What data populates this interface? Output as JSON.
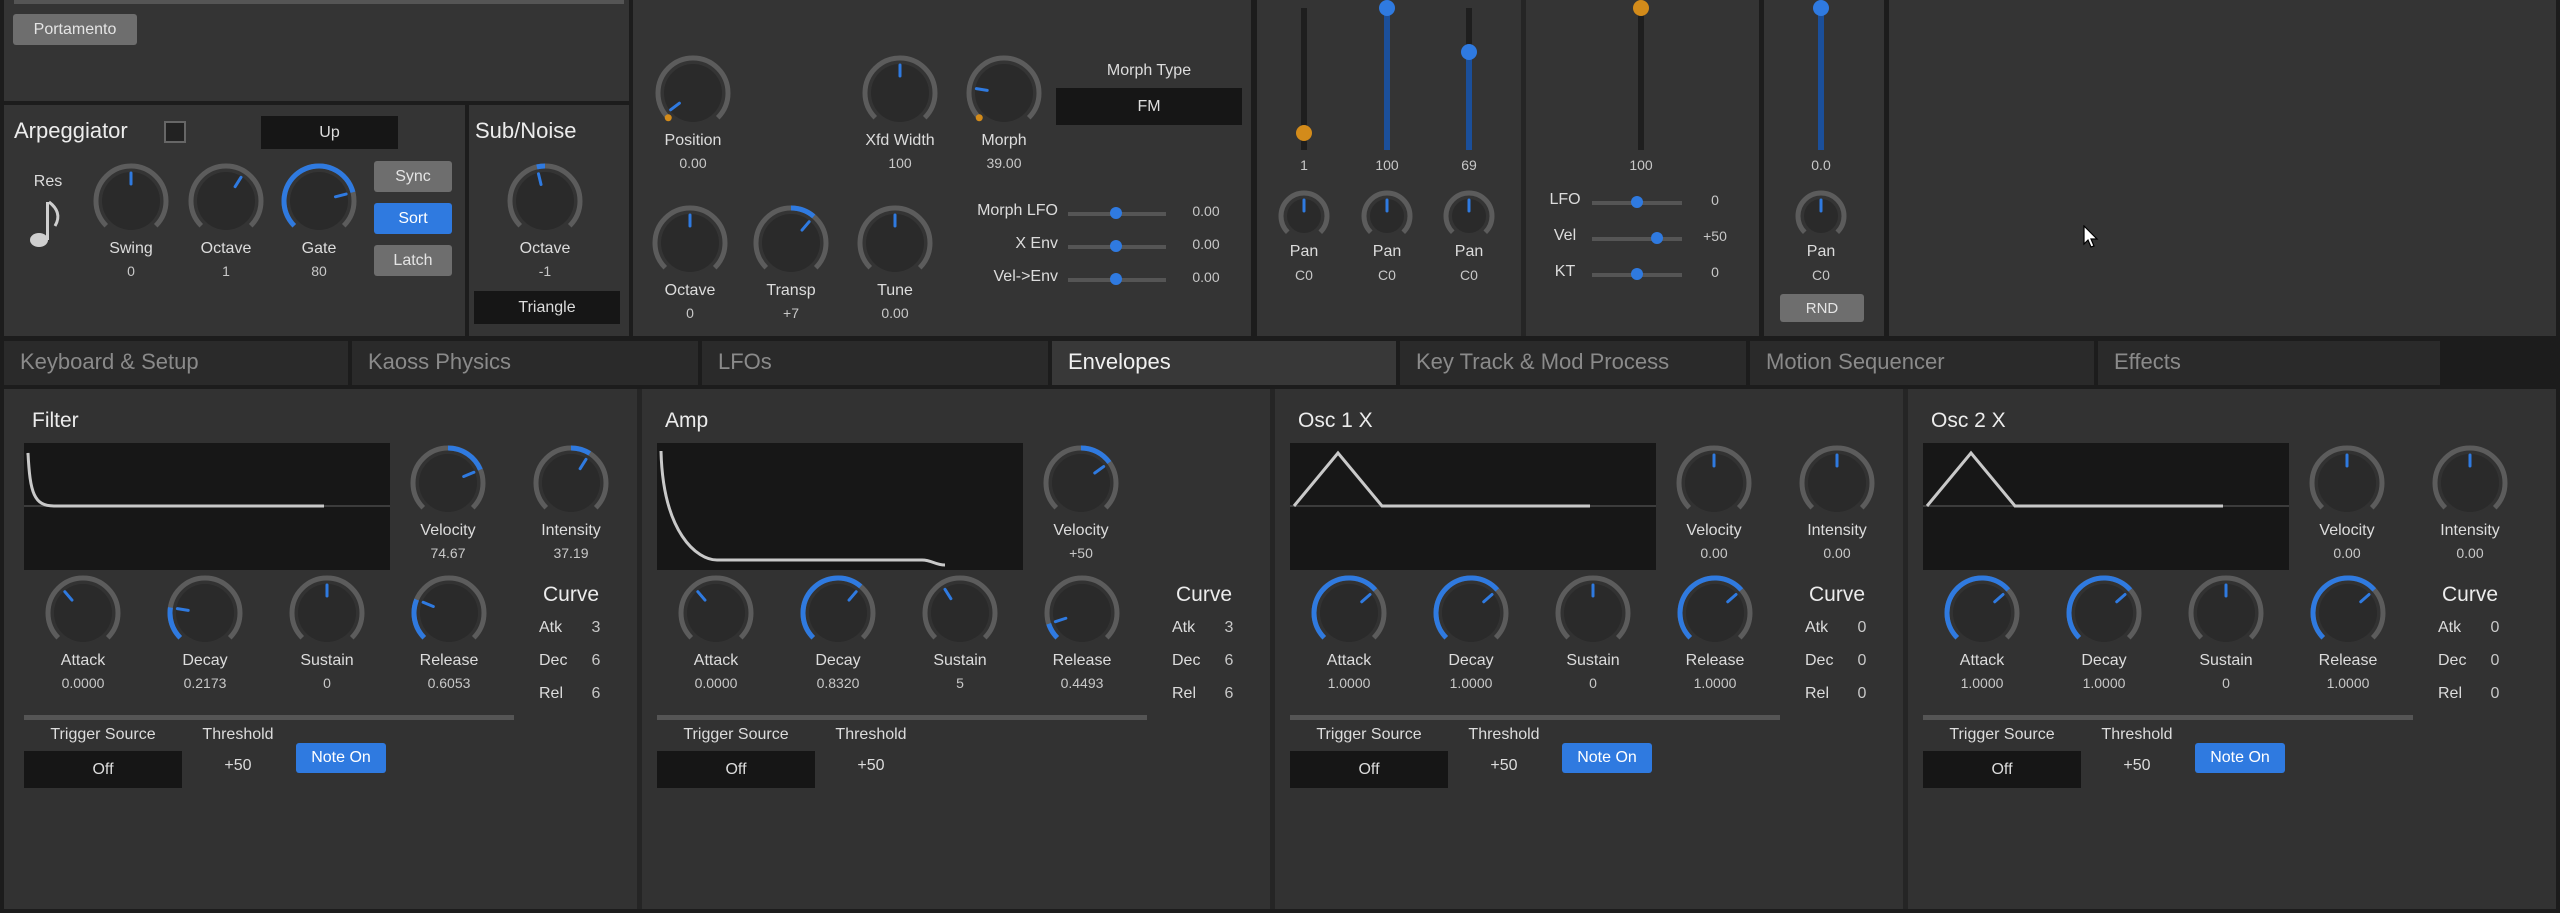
{
  "top": {
    "portamento_label": "Portamento",
    "arpeggiator": {
      "title": "Arpeggiator",
      "mode": "Up",
      "res_label": "Res",
      "knobs": [
        {
          "label": "Swing",
          "value": "0"
        },
        {
          "label": "Octave",
          "value": "1"
        },
        {
          "label": "Gate",
          "value": "80"
        }
      ],
      "buttons": [
        "Sync",
        "Sort",
        "Latch"
      ]
    },
    "subnoise": {
      "title": "Sub/Noise",
      "octave_label": "Octave",
      "octave_value": "-1",
      "wave": "Triangle"
    },
    "osc": {
      "knobs": [
        {
          "label": "Position",
          "value": "0.00"
        },
        {
          "label": "Xfd Width",
          "value": "100"
        },
        {
          "label": "Morph",
          "value": "39.00"
        },
        {
          "label": "Octave",
          "value": "0"
        },
        {
          "label": "Transp",
          "value": "+7"
        },
        {
          "label": "Tune",
          "value": "0.00"
        }
      ],
      "morph_type_label": "Morph Type",
      "morph_type_value": "FM",
      "sliders": [
        {
          "label": "Morph LFO",
          "value": "0.00"
        },
        {
          "label": "X Env",
          "value": "0.00"
        },
        {
          "label": "Vel->Env",
          "value": "0.00"
        }
      ]
    },
    "mixer": {
      "faders": [
        {
          "value": "1",
          "level": 0.12
        },
        {
          "value": "100",
          "level": 1.0
        },
        {
          "value": "69",
          "level": 0.69
        }
      ],
      "pan_label": "Pan",
      "pan_value": "C0"
    },
    "fader_group2": {
      "fader_value": "100",
      "mods": [
        {
          "label": "LFO",
          "value": "0"
        },
        {
          "label": "Vel",
          "value": "+50"
        },
        {
          "label": "KT",
          "value": "0"
        }
      ]
    },
    "noise_channel": {
      "fader_value": "0.0",
      "pan_label": "Pan",
      "pan_value": "C0",
      "rnd_label": "RND"
    }
  },
  "tabs": [
    "Keyboard & Setup",
    "Kaoss Physics",
    "LFOs",
    "Envelopes",
    "Key Track & Mod Process",
    "Motion Sequencer",
    "Effects"
  ],
  "active_tab": "Envelopes",
  "envelopes": [
    {
      "title": "Filter",
      "adsr": [
        {
          "label": "Attack",
          "value": "0.0000"
        },
        {
          "label": "Decay",
          "value": "0.2173"
        },
        {
          "label": "Sustain",
          "value": "0"
        },
        {
          "label": "Release",
          "value": "0.6053"
        }
      ],
      "velocity": {
        "label": "Velocity",
        "value": "74.67"
      },
      "intensity": {
        "label": "Intensity",
        "value": "37.19"
      },
      "curve": {
        "title": "Curve",
        "atk_label": "Atk",
        "atk": "3",
        "dec_label": "Dec",
        "dec": "6",
        "rel_label": "Rel",
        "rel": "6"
      },
      "trigger_label": "Trigger Source",
      "trigger_value": "Off",
      "threshold_label": "Threshold",
      "threshold_value": "+50",
      "note_on_label": "Note On"
    },
    {
      "title": "Amp",
      "adsr": [
        {
          "label": "Attack",
          "value": "0.0000"
        },
        {
          "label": "Decay",
          "value": "0.8320"
        },
        {
          "label": "Sustain",
          "value": "5"
        },
        {
          "label": "Release",
          "value": "0.4493"
        }
      ],
      "velocity": {
        "label": "Velocity",
        "value": "+50"
      },
      "curve": {
        "title": "Curve",
        "atk_label": "Atk",
        "atk": "3",
        "dec_label": "Dec",
        "dec": "6",
        "rel_label": "Rel",
        "rel": "6"
      },
      "trigger_label": "Trigger Source",
      "trigger_value": "Off",
      "threshold_label": "Threshold",
      "threshold_value": "+50"
    },
    {
      "title": "Osc 1 X",
      "adsr": [
        {
          "label": "Attack",
          "value": "1.0000"
        },
        {
          "label": "Decay",
          "value": "1.0000"
        },
        {
          "label": "Sustain",
          "value": "0"
        },
        {
          "label": "Release",
          "value": "1.0000"
        }
      ],
      "velocity": {
        "label": "Velocity",
        "value": "0.00"
      },
      "intensity": {
        "label": "Intensity",
        "value": "0.00"
      },
      "curve": {
        "title": "Curve",
        "atk_label": "Atk",
        "atk": "0",
        "dec_label": "Dec",
        "dec": "0",
        "rel_label": "Rel",
        "rel": "0"
      },
      "trigger_label": "Trigger Source",
      "trigger_value": "Off",
      "threshold_label": "Threshold",
      "threshold_value": "+50",
      "note_on_label": "Note On"
    },
    {
      "title": "Osc 2 X",
      "adsr": [
        {
          "label": "Attack",
          "value": "1.0000"
        },
        {
          "label": "Decay",
          "value": "1.0000"
        },
        {
          "label": "Sustain",
          "value": "0"
        },
        {
          "label": "Release",
          "value": "1.0000"
        }
      ],
      "velocity": {
        "label": "Velocity",
        "value": "0.00"
      },
      "intensity": {
        "label": "Intensity",
        "value": "0.00"
      },
      "curve": {
        "title": "Curve",
        "atk_label": "Atk",
        "atk": "0",
        "dec_label": "Dec",
        "dec": "0",
        "rel_label": "Rel",
        "rel": "0"
      },
      "trigger_label": "Trigger Source",
      "trigger_value": "Off",
      "threshold_label": "Threshold",
      "threshold_value": "+50",
      "note_on_label": "Note On"
    }
  ],
  "colors": {
    "accent": "#2f7ae0",
    "orange": "#d38b1a",
    "panel": "#343434",
    "dark": "#161616",
    "knob_track": "#5c5c5c"
  },
  "icons": {
    "res": "eighth-note-icon",
    "cursor": "mouse-cursor-icon"
  }
}
